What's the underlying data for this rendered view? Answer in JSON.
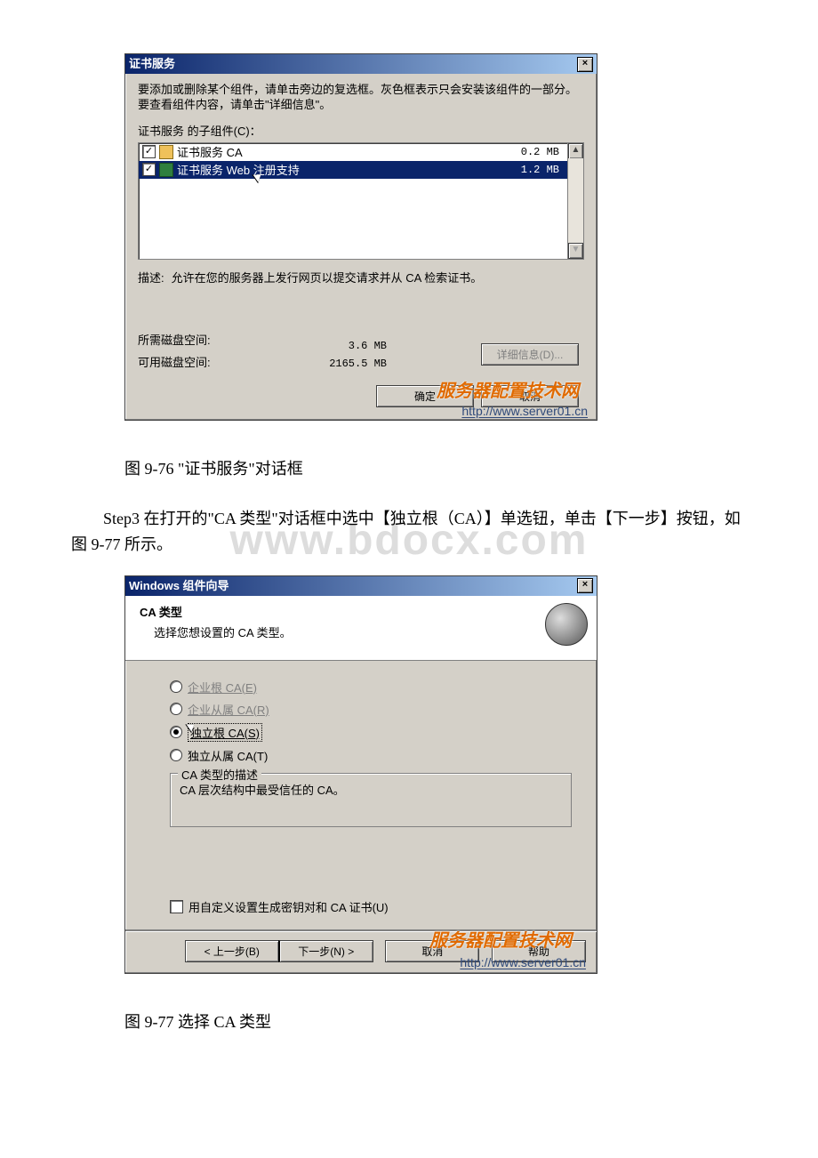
{
  "dialog1": {
    "title": "证书服务",
    "hint": "要添加或删除某个组件，请单击旁边的复选框。灰色框表示只会安装该组件的一部分。要查看组件内容，请单击\"详细信息\"。",
    "sub_label": "证书服务 的子组件(C)：",
    "items": [
      {
        "checked": true,
        "name": "证书服务 CA",
        "size": "0.2 MB",
        "selected": false,
        "icon": "cert"
      },
      {
        "checked": true,
        "name": "证书服务 Web 注册支持",
        "size": "1.2 MB",
        "selected": true,
        "icon": "web"
      }
    ],
    "desc_label": "描述:",
    "desc_text": "允许在您的服务器上发行网页以提交请求并从 CA 检索证书。",
    "space_required_label": "所需磁盘空间:",
    "space_required_value": "3.6 MB",
    "space_available_label": "可用磁盘空间:",
    "space_available_value": "2165.5 MB",
    "details_btn": "详细信息(D)...",
    "ok_btn": "确定",
    "cancel_btn": "取消"
  },
  "caption1": "图 9-76 \"证书服务\"对话框",
  "paragraph": "Step3 在打开的\"CA 类型\"对话框中选中【独立根（CA）】单选钮，单击【下一步】按钮，如图 9-77 所示。",
  "watermark": "www.bdocx.com",
  "dialog2": {
    "title": "Windows 组件向导",
    "header_title": "CA 类型",
    "header_sub": "选择您想设置的 CA 类型。",
    "radios": [
      {
        "label": "企业根 CA(E)",
        "enabled": false,
        "selected": false
      },
      {
        "label": "企业从属 CA(R)",
        "enabled": false,
        "selected": false
      },
      {
        "label": "独立根 CA(S)",
        "enabled": true,
        "selected": true
      },
      {
        "label": "独立从属 CA(T)",
        "enabled": true,
        "selected": false
      }
    ],
    "group_legend": "CA 类型的描述",
    "group_text": "CA 层次结构中最受信任的 CA。",
    "custom_check_label": "用自定义设置生成密钥对和 CA 证书(U)",
    "back_btn": "< 上一步(B)",
    "next_btn": "下一步(N) >",
    "cancel_btn": "取消",
    "help_btn": "帮助"
  },
  "caption2": "图 9-77 选择 CA 类型",
  "overlay": {
    "brand": "服务器配置技术网",
    "url": "http://www.server01.cn"
  }
}
